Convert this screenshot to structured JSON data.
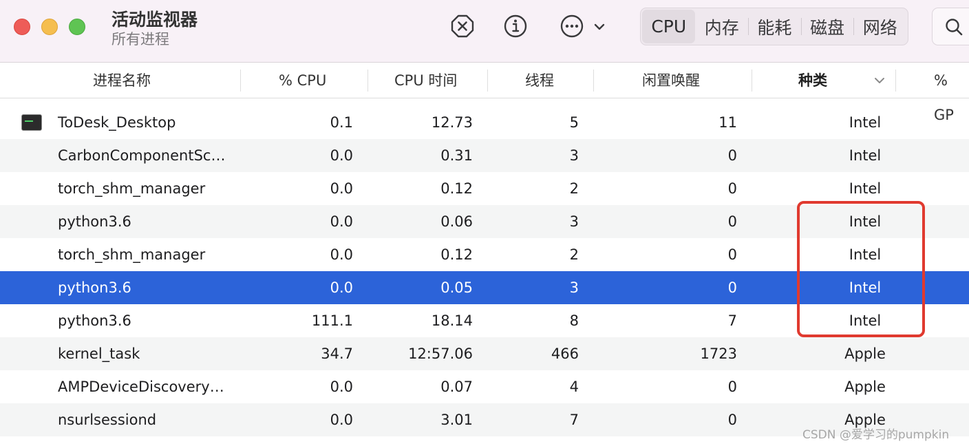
{
  "window": {
    "title": "活动监视器",
    "subtitle": "所有进程"
  },
  "toolbar": {
    "stop_icon": "xmark-octagon-icon",
    "info_icon": "info-circle-icon",
    "more_icon": "ellipsis-circle-icon",
    "tabs": [
      "CPU",
      "内存",
      "能耗",
      "磁盘",
      "网络"
    ],
    "active_tab": "CPU"
  },
  "columns": {
    "name": "进程名称",
    "cpu": "% CPU",
    "cpu_time": "CPU 时间",
    "threads": "线程",
    "idle_wakeups": "闲置唤醒",
    "kind": "种类",
    "gpu": "% GP"
  },
  "rows": [
    {
      "name": "ToDesk_Desktop",
      "cpu": "0.1",
      "cpu_time": "12.73",
      "threads": "5",
      "idle": "11",
      "kind": "Intel",
      "has_icon": true
    },
    {
      "name": "CarbonComponentSc…",
      "cpu": "0.0",
      "cpu_time": "0.31",
      "threads": "3",
      "idle": "0",
      "kind": "Intel"
    },
    {
      "name": "torch_shm_manager",
      "cpu": "0.0",
      "cpu_time": "0.12",
      "threads": "2",
      "idle": "0",
      "kind": "Intel"
    },
    {
      "name": "python3.6",
      "cpu": "0.0",
      "cpu_time": "0.06",
      "threads": "3",
      "idle": "0",
      "kind": "Intel"
    },
    {
      "name": "torch_shm_manager",
      "cpu": "0.0",
      "cpu_time": "0.12",
      "threads": "2",
      "idle": "0",
      "kind": "Intel"
    },
    {
      "name": "python3.6",
      "cpu": "0.0",
      "cpu_time": "0.05",
      "threads": "3",
      "idle": "0",
      "kind": "Intel",
      "selected": true
    },
    {
      "name": "python3.6",
      "cpu": "111.1",
      "cpu_time": "18.14",
      "threads": "8",
      "idle": "7",
      "kind": "Intel"
    },
    {
      "name": "kernel_task",
      "cpu": "34.7",
      "cpu_time": "12:57.06",
      "threads": "466",
      "idle": "1723",
      "kind": "Apple"
    },
    {
      "name": "AMPDeviceDiscovery…",
      "cpu": "0.0",
      "cpu_time": "0.07",
      "threads": "4",
      "idle": "0",
      "kind": "Apple"
    },
    {
      "name": "nsurlsessiond",
      "cpu": "0.0",
      "cpu_time": "3.01",
      "threads": "7",
      "idle": "0",
      "kind": "Apple"
    }
  ],
  "colors": {
    "selection": "#2c63d9",
    "highlight_box": "#e03a2f"
  },
  "watermark": "CSDN @爱学习的pumpkin"
}
